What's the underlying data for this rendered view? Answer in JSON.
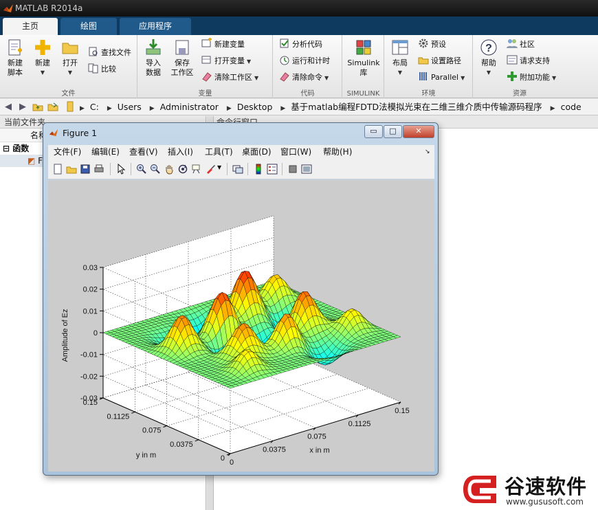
{
  "window": {
    "title": "MATLAB R2014a"
  },
  "tabs": [
    {
      "label": "主页",
      "active": true
    },
    {
      "label": "绘图",
      "active": false
    },
    {
      "label": "应用程序",
      "active": false
    }
  ],
  "toolstrip": {
    "file": {
      "label": "文件",
      "new_script": "新建\n脚本",
      "new": "新建",
      "open": "打开",
      "find_files": "查找文件",
      "compare": "比较"
    },
    "variable": {
      "label": "变量",
      "import_data": "导入\n数据",
      "save_workspace": "保存\n工作区",
      "new_variable": "新建变量",
      "open_variable": "打开变量",
      "clear_workspace": "清除工作区"
    },
    "code": {
      "label": "代码",
      "analyze_code": "分析代码",
      "run_and_time": "运行和计时",
      "clear_commands": "清除命令"
    },
    "simulink": {
      "label": "SIMULINK",
      "library": "Simulink\n库"
    },
    "environment": {
      "label": "环境",
      "layout": "布局",
      "preferences": "预设",
      "set_path": "设置路径",
      "parallel": "Parallel"
    },
    "resources": {
      "label": "资源",
      "help": "帮助",
      "community": "社区",
      "request_support": "请求支持",
      "add_ons": "附加功能"
    }
  },
  "address": {
    "crumbs": [
      "C:",
      "Users",
      "Administrator",
      "Desktop",
      "基于matlab编程FDTD法模拟光束在二维三维介质中传输源码程序",
      "code"
    ]
  },
  "file_pane": {
    "title": "当前文件夹",
    "column_name": "名称",
    "group": "函数",
    "item_initial": "F"
  },
  "command_pane": {
    "title": "命令行窗口"
  },
  "figure": {
    "title": "Figure 1",
    "menus": [
      "文件(F)",
      "编辑(E)",
      "查看(V)",
      "插入(I)",
      "工具(T)",
      "桌面(D)",
      "窗口(W)",
      "帮助(H)"
    ],
    "win_buttons": {
      "minimize": "▭",
      "maximize": "□",
      "close": "✕"
    },
    "toolbar_icons": [
      "new-figure-icon",
      "open-file-icon",
      "save-icon",
      "print-icon",
      "edit-plot-arrow-icon",
      "zoom-in-icon",
      "zoom-out-icon",
      "pan-hand-icon",
      "rotate-3d-icon",
      "data-cursor-icon",
      "brush-icon",
      "link-plot-icon",
      "colorbar-icon",
      "legend-icon",
      "hide-plot-tools-icon",
      "show-plot-tools-icon"
    ]
  },
  "chart_data": {
    "type": "surface",
    "title": "",
    "xlabel": "x in m",
    "ylabel": "y in m",
    "zlabel": "Amplitude of Ez",
    "x_ticks": [
      "0",
      "0.0375",
      "0.075",
      "0.1125",
      "0.15"
    ],
    "y_ticks": [
      "0",
      "0.0375",
      "0.075",
      "0.1125",
      "0.15"
    ],
    "z_ticks": [
      "-0.03",
      "-0.02",
      "-0.01",
      "0",
      "0.01",
      "0.02",
      "0.03"
    ],
    "xlim": [
      0,
      0.15
    ],
    "ylim": [
      0,
      0.15
    ],
    "zlim": [
      -0.03,
      0.03
    ],
    "grid": true,
    "colormap": "jet",
    "edge_color": "#000000",
    "surface": {
      "n": 41,
      "components": [
        {
          "a": 0.022,
          "cx": 0.02,
          "cy": 0.085,
          "sx": 0.008,
          "sy": 0.009
        },
        {
          "a": -0.012,
          "cx": 0.035,
          "cy": 0.11,
          "sx": 0.01,
          "sy": 0.01
        },
        {
          "a": 0.018,
          "cx": 0.045,
          "cy": 0.045,
          "sx": 0.009,
          "sy": 0.009
        },
        {
          "a": 0.021,
          "cx": 0.06,
          "cy": 0.09,
          "sx": 0.009,
          "sy": 0.009
        },
        {
          "a": -0.02,
          "cx": 0.055,
          "cy": 0.068,
          "sx": 0.009,
          "sy": 0.009
        },
        {
          "a": 0.017,
          "cx": 0.08,
          "cy": 0.04,
          "sx": 0.008,
          "sy": 0.008
        },
        {
          "a": -0.018,
          "cx": 0.085,
          "cy": 0.07,
          "sx": 0.01,
          "sy": 0.01
        },
        {
          "a": 0.024,
          "cx": 0.095,
          "cy": 0.11,
          "sx": 0.009,
          "sy": 0.009
        },
        {
          "a": 0.02,
          "cx": 0.11,
          "cy": 0.06,
          "sx": 0.009,
          "sy": 0.009
        },
        {
          "a": -0.015,
          "cx": 0.12,
          "cy": 0.09,
          "sx": 0.01,
          "sy": 0.01
        },
        {
          "a": 0.019,
          "cx": 0.13,
          "cy": 0.12,
          "sx": 0.008,
          "sy": 0.008
        },
        {
          "a": 0.016,
          "cx": 0.135,
          "cy": 0.035,
          "sx": 0.008,
          "sy": 0.008
        },
        {
          "a": -0.014,
          "cx": 0.07,
          "cy": 0.125,
          "sx": 0.01,
          "sy": 0.01
        },
        {
          "a": 0.015,
          "cx": 0.03,
          "cy": 0.02,
          "sx": 0.008,
          "sy": 0.008
        },
        {
          "a": -0.012,
          "cx": 0.1,
          "cy": 0.02,
          "sx": 0.01,
          "sy": 0.01
        }
      ]
    }
  },
  "watermark": {
    "text": "谷速软件",
    "url": "www.gususoft.com"
  },
  "colors": {
    "tab_bar": "#0d3a5e",
    "tab_inactive": "#1f5a8a",
    "figure_bg": "#cccccc",
    "brand_red": "#d42020"
  }
}
